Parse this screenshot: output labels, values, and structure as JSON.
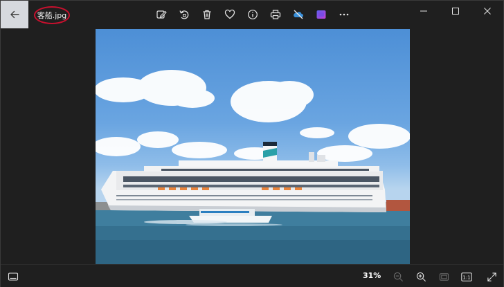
{
  "titlebar": {
    "filename": "客船.jpg",
    "back_icon": "arrow-left-icon"
  },
  "toolbar": {
    "tools": [
      {
        "name": "edit-image-icon"
      },
      {
        "name": "rotate-icon"
      },
      {
        "name": "delete-icon"
      },
      {
        "name": "favorite-heart-icon"
      },
      {
        "name": "file-info-icon"
      },
      {
        "name": "print-icon"
      },
      {
        "name": "onedrive-sync-off-icon"
      },
      {
        "name": "clipchamp-icon"
      },
      {
        "name": "more-options-icon"
      }
    ]
  },
  "window_controls": [
    "minimize-icon",
    "maximize-icon",
    "close-icon"
  ],
  "bottombar": {
    "zoom_level": "31%",
    "icons": [
      "filmstrip-icon",
      "zoom-out-icon",
      "zoom-in-icon",
      "fit-to-window-icon",
      "actual-size-icon",
      "full-screen-icon"
    ],
    "actual_size_label": "1:1"
  },
  "colors": {
    "background": "#1f1f1f",
    "back_button": "#d6d9de",
    "annotation_ring": "#c8102e"
  }
}
